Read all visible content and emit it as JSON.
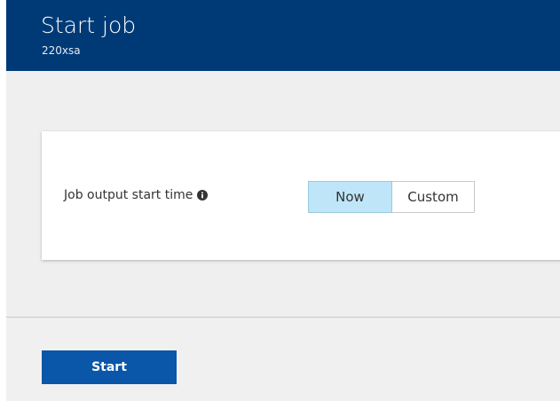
{
  "header": {
    "title": "Start job",
    "subtitle": "220xsa"
  },
  "form": {
    "field_label": "Job output start time",
    "info_icon": "info-icon",
    "options": [
      {
        "label": "Now",
        "selected": true
      },
      {
        "label": "Custom",
        "selected": false
      }
    ]
  },
  "footer": {
    "start_label": "Start"
  },
  "colors": {
    "header_bg": "#003a76",
    "selected_option_bg": "#bfe6f8",
    "primary_button": "#0a56a8"
  }
}
